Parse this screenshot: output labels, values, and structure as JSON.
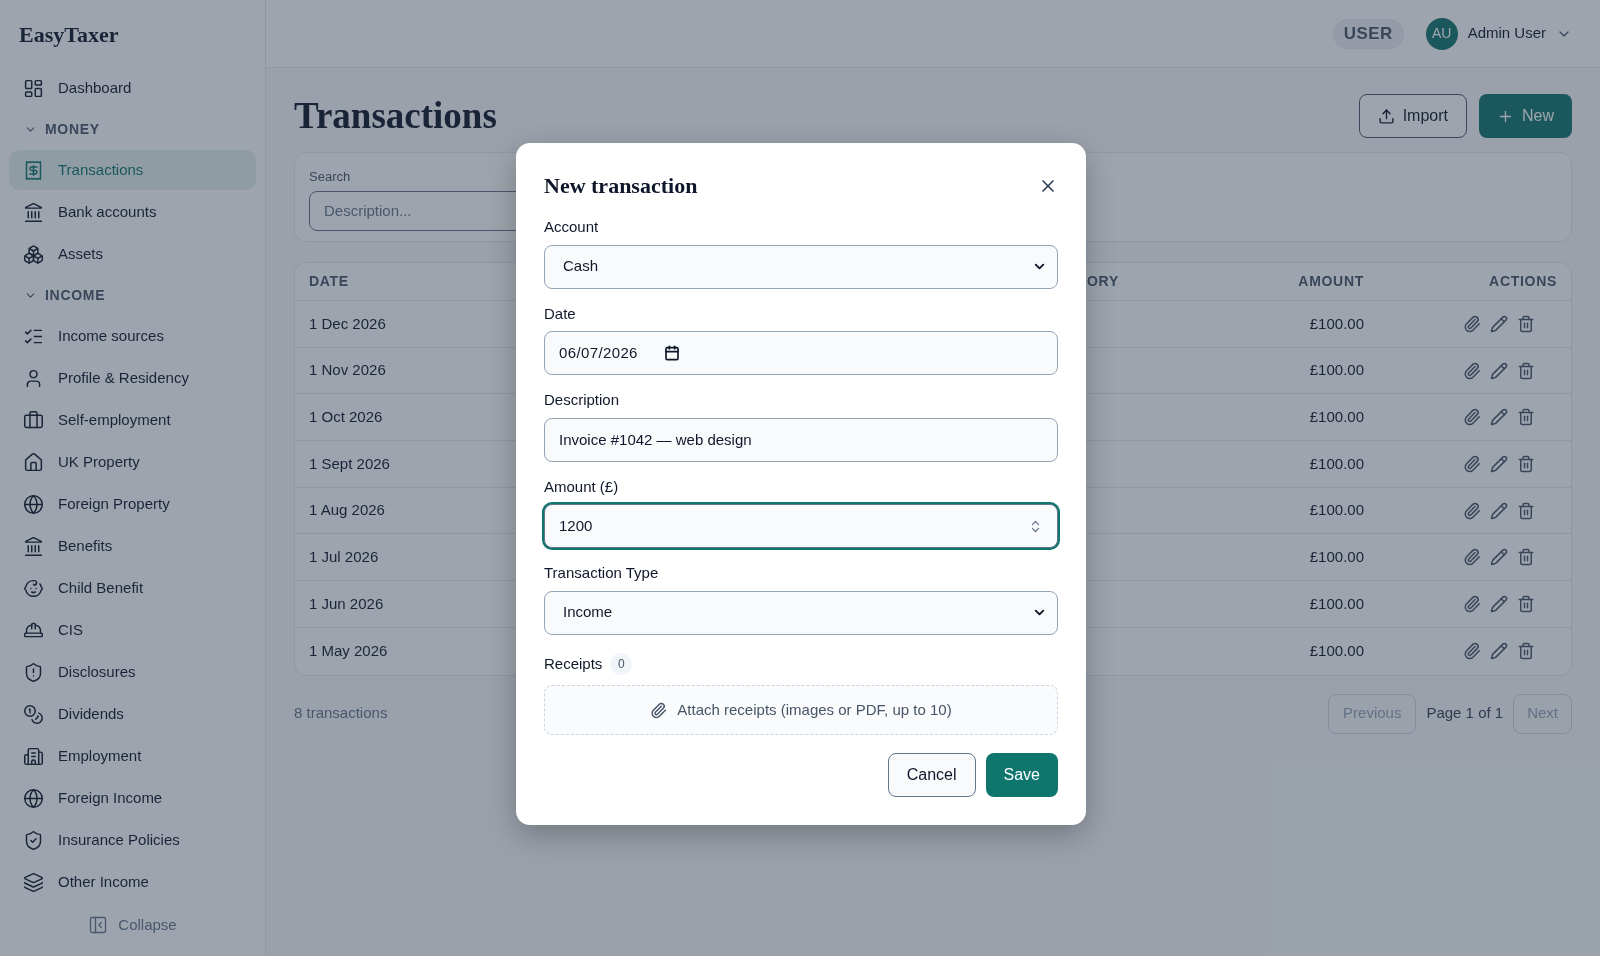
{
  "app": {
    "logo": "EasyTaxer"
  },
  "sidebar": {
    "items": [
      {
        "kind": "link",
        "label": "Dashboard",
        "selected": false
      },
      {
        "kind": "section",
        "label": "MONEY",
        "expanded": true
      },
      {
        "kind": "link",
        "label": "Transactions",
        "selected": true
      },
      {
        "kind": "link",
        "label": "Bank accounts",
        "selected": false
      },
      {
        "kind": "link",
        "label": "Assets",
        "selected": false
      },
      {
        "kind": "section",
        "label": "INCOME",
        "expanded": true
      },
      {
        "kind": "link",
        "label": "Income sources",
        "selected": false
      },
      {
        "kind": "link",
        "label": "Profile & Residency",
        "selected": false
      },
      {
        "kind": "link",
        "label": "Self-employment",
        "selected": false
      },
      {
        "kind": "link",
        "label": "UK Property",
        "selected": false
      },
      {
        "kind": "link",
        "label": "Foreign Property",
        "selected": false
      },
      {
        "kind": "link",
        "label": "Benefits",
        "selected": false
      },
      {
        "kind": "link",
        "label": "Child Benefit",
        "selected": false
      },
      {
        "kind": "link",
        "label": "CIS",
        "selected": false
      },
      {
        "kind": "link",
        "label": "Disclosures",
        "selected": false
      },
      {
        "kind": "link",
        "label": "Dividends",
        "selected": false
      },
      {
        "kind": "link",
        "label": "Employment",
        "selected": false
      },
      {
        "kind": "link",
        "label": "Foreign Income",
        "selected": false
      },
      {
        "kind": "link",
        "label": "Insurance Policies",
        "selected": false
      },
      {
        "kind": "link",
        "label": "Other Income",
        "selected": false
      }
    ],
    "collapse": "Collapse"
  },
  "header": {
    "role_badge": "USER",
    "avatar": "AU",
    "user_name": "Admin User"
  },
  "page": {
    "title": "Transactions",
    "import_button": "Import",
    "new_button": "New"
  },
  "search": {
    "label": "Search",
    "placeholder": "Description..."
  },
  "table": {
    "columns": [
      "DATE",
      "ORY",
      "AMOUNT",
      "ACTIONS"
    ],
    "rows": [
      {
        "date": "1 Dec 2026",
        "amount": "£100.00"
      },
      {
        "date": "1 Nov 2026",
        "amount": "£100.00"
      },
      {
        "date": "1 Oct 2026",
        "amount": "£100.00"
      },
      {
        "date": "1 Sept 2026",
        "amount": "£100.00"
      },
      {
        "date": "1 Aug 2026",
        "amount": "£100.00"
      },
      {
        "date": "1 Jul 2026",
        "amount": "£100.00"
      },
      {
        "date": "1 Jun 2026",
        "amount": "£100.00"
      },
      {
        "date": "1 May 2026",
        "amount": "£100.00"
      }
    ]
  },
  "footer": {
    "count": "8 transactions",
    "previous": {
      "label": "Previous",
      "disabled": true
    },
    "page": "Page 1 of 1",
    "next": {
      "label": "Next",
      "disabled": true
    }
  },
  "dialog": {
    "title": "New transaction",
    "fields": [
      {
        "kind": "select",
        "label": "Account",
        "value": "Cash",
        "focused": false
      },
      {
        "kind": "date",
        "label": "Date",
        "value": "06/07/2026",
        "focused": false
      },
      {
        "kind": "text",
        "label": "Description",
        "value": "Invoice #1042 — web design",
        "focused": false
      },
      {
        "kind": "number",
        "label": "Amount (£)",
        "value": "1200",
        "focused": true
      },
      {
        "kind": "select",
        "label": "Transaction Type",
        "value": "Income",
        "focused": false
      }
    ],
    "receipts": {
      "label": "Receipts",
      "count": "0",
      "dropzone": "Attach receipts (images or PDF, up to 10)"
    },
    "cancel": "Cancel",
    "save": "Save"
  }
}
